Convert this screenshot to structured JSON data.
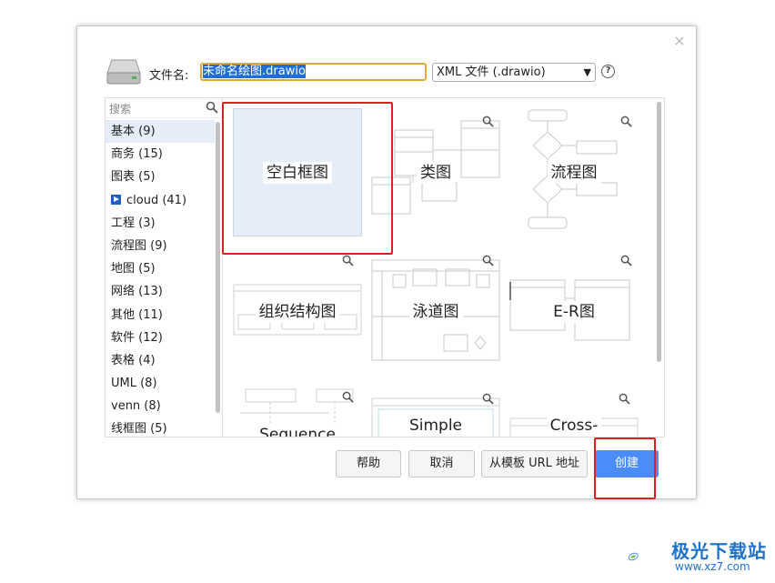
{
  "dialog": {
    "close_glyph": "×",
    "filename_label": "文件名:",
    "filename_value": "未命名绘图.drawio",
    "format_value": "XML 文件 (.drawio)",
    "help_glyph": "?"
  },
  "sidebar": {
    "search_placeholder": "搜索",
    "categories": [
      {
        "label": "基本 (9)"
      },
      {
        "label": "商务 (15)"
      },
      {
        "label": "图表 (5)"
      },
      {
        "label": "cloud (41)"
      },
      {
        "label": "工程 (3)"
      },
      {
        "label": "流程图 (9)"
      },
      {
        "label": "地图 (5)"
      },
      {
        "label": "网络 (13)"
      },
      {
        "label": "其他 (11)"
      },
      {
        "label": "软件 (12)"
      },
      {
        "label": "表格 (4)"
      },
      {
        "label": "UML (8)"
      },
      {
        "label": "venn (8)"
      },
      {
        "label": "线框图 (5)"
      }
    ]
  },
  "templates": [
    {
      "label": "空白框图"
    },
    {
      "label": "类图"
    },
    {
      "label": "流程图"
    },
    {
      "label": "组织结构图"
    },
    {
      "label": "泳道图"
    },
    {
      "label": "E-R图"
    },
    {
      "label": "Sequence"
    },
    {
      "label": "Simple"
    },
    {
      "label": "Cross-"
    }
  ],
  "buttons": {
    "help": "帮助",
    "cancel": "取消",
    "from_url": "从模板 URL 地址",
    "create": "创建"
  },
  "watermark": {
    "name": "极光下载站",
    "url": "www.xz7.com"
  },
  "colors": {
    "accent": "#4b8df8",
    "highlight_red": "#e02020",
    "selection_bg": "#e5eef8"
  }
}
